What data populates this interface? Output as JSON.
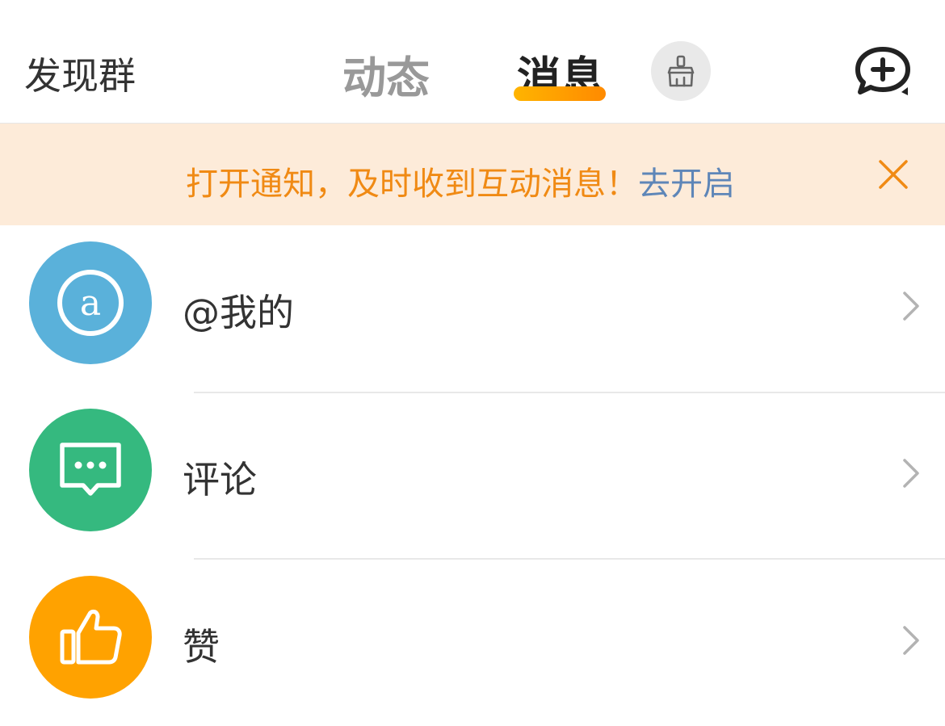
{
  "header": {
    "discover_label": "发现群",
    "tabs": [
      {
        "label": "动态",
        "active": false
      },
      {
        "label": "消息",
        "active": true
      }
    ],
    "clean_icon": "broom-icon",
    "compose_icon": "chat-plus-icon",
    "accent_color": "#ff9a00"
  },
  "banner": {
    "text": "打开通知，及时收到互动消息！",
    "link": "去开启",
    "close_icon": "close-icon",
    "text_color": "#f08a14",
    "link_color": "#5e86b8",
    "background": "#fdebd9"
  },
  "list": [
    {
      "label": "@我的",
      "icon": "at-icon",
      "color": "#5ab1da"
    },
    {
      "label": "评论",
      "icon": "comment-icon",
      "color": "#35b97f"
    },
    {
      "label": "赞",
      "icon": "thumbs-up-icon",
      "color": "#ffa200"
    }
  ]
}
